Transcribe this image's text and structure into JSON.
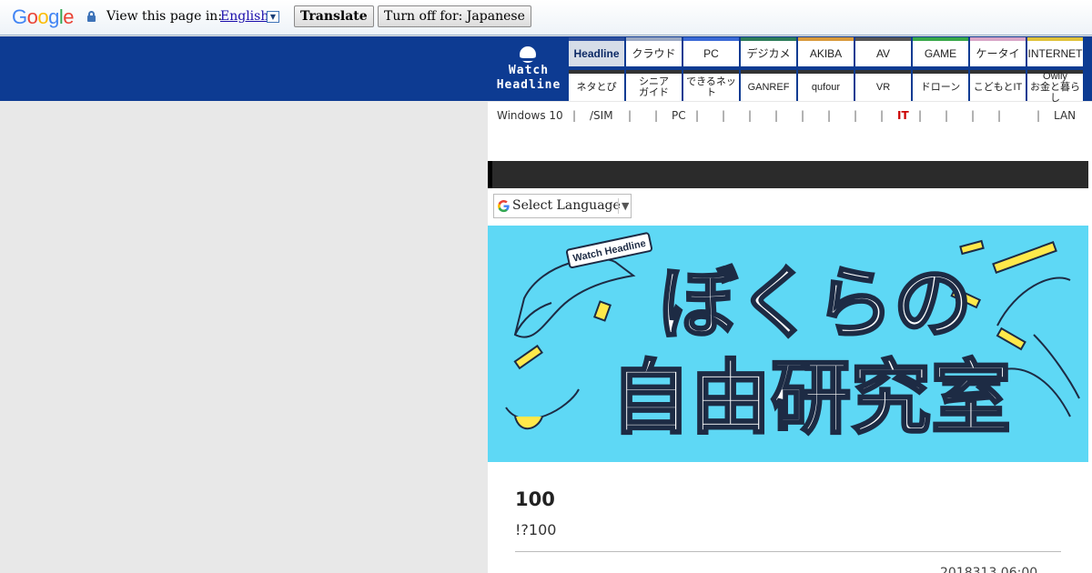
{
  "translate_bar": {
    "logo": "Google",
    "view_text": "View this page in:",
    "language": "English",
    "translate_label": "Translate",
    "turnoff_label": "Turn off for: Japanese"
  },
  "site_logo": {
    "line1": "Watch",
    "line2": "Headline"
  },
  "nav": {
    "row1": [
      "Headline",
      "クラウド",
      "PC",
      "デジカメ",
      "AKIBA",
      "AV",
      "GAME",
      "ケータイ",
      "INTERNET"
    ],
    "row1_colors": [
      "#2e4f9e",
      "#9aa8c4",
      "#3b6ad6",
      "#2e7d5b",
      "#d99a3c",
      "#555555",
      "#39a84a",
      "#d9a6c8",
      "#e0c23a"
    ],
    "row2": [
      "ネタとぴ",
      "シニア\nガイド",
      "できるネット",
      "GANREF",
      "qufour",
      "VR",
      "ドローン",
      "こどもとIT",
      "Owlly\nお金と暮らし"
    ]
  },
  "sublinks": {
    "windows": "Windows 10",
    "sim": "/SIM",
    "pc": "PC",
    "it": "IT",
    "lan": "LAN"
  },
  "gt_widget": {
    "label": "Select Language"
  },
  "banner": {
    "tag": "Watch Headline",
    "title_line1": "ぼくらの",
    "title_line2": "自由研究室"
  },
  "post": {
    "title": "100",
    "subtitle": "!?100",
    "date": "2018313 06:00"
  }
}
